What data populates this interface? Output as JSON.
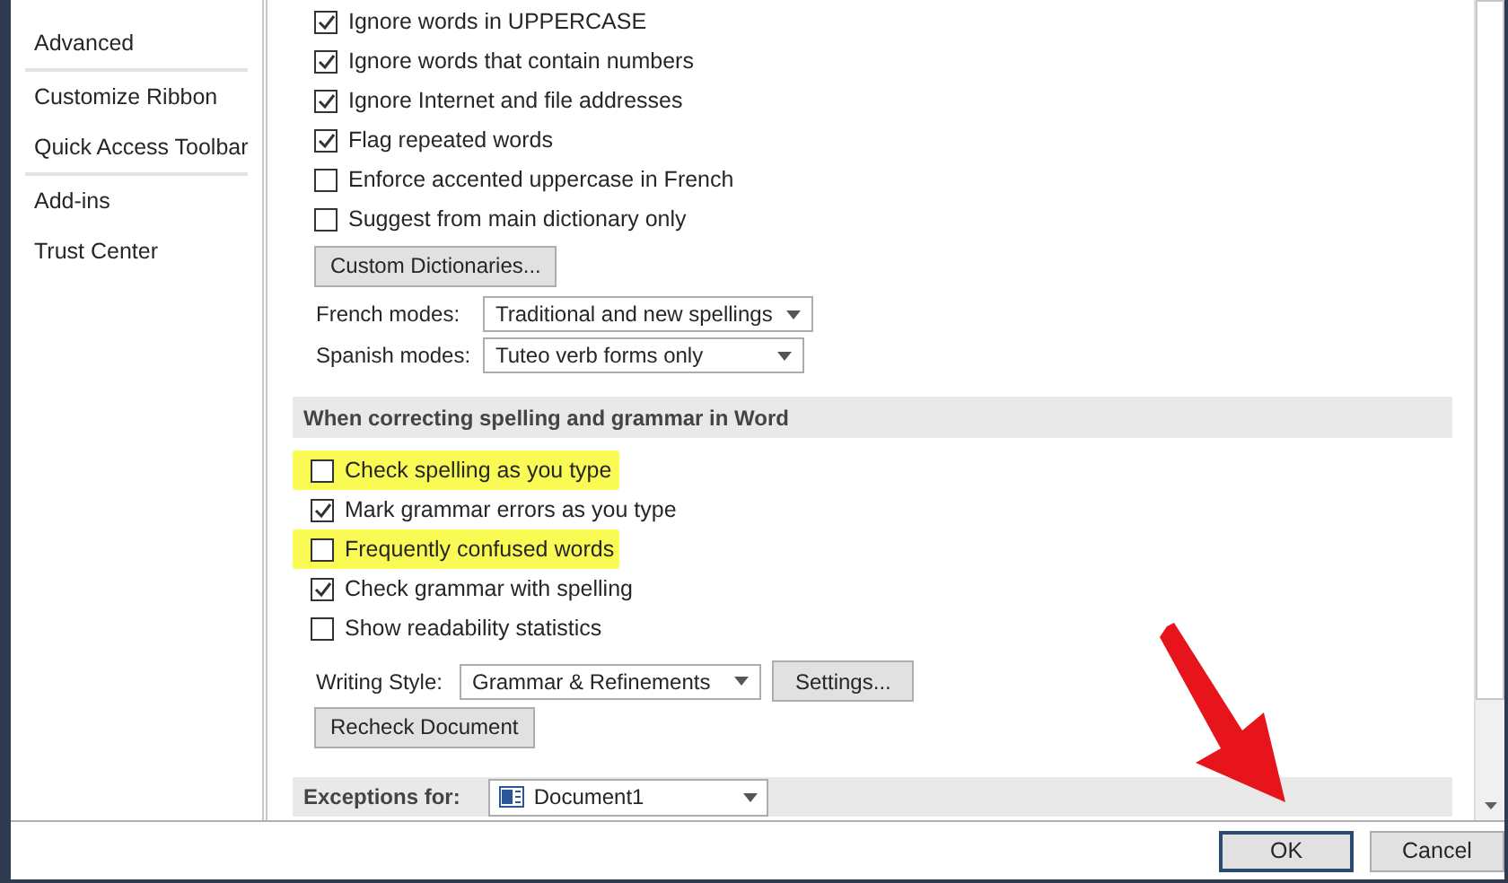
{
  "sidebar": {
    "items": [
      {
        "label": "Advanced",
        "selected": false,
        "divider_after": true
      },
      {
        "label": "Customize Ribbon",
        "selected": false,
        "divider_after": false
      },
      {
        "label": "Quick Access Toolbar",
        "selected": false,
        "divider_after": true
      },
      {
        "label": "Add-ins",
        "selected": false,
        "divider_after": false
      },
      {
        "label": "Trust Center",
        "selected": false,
        "divider_after": false
      }
    ]
  },
  "office_options": [
    {
      "label": "Ignore words in UPPERCASE",
      "checked": true
    },
    {
      "label": "Ignore words that contain numbers",
      "checked": true
    },
    {
      "label": "Ignore Internet and file addresses",
      "checked": true
    },
    {
      "label": "Flag repeated words",
      "checked": true
    },
    {
      "label": "Enforce accented uppercase in French",
      "checked": false
    },
    {
      "label": "Suggest from main dictionary only",
      "checked": false
    }
  ],
  "custom_dictionaries_button": "Custom Dictionaries...",
  "modes": [
    {
      "label": "French modes:",
      "value": "Traditional and new spellings"
    },
    {
      "label": "Spanish modes:",
      "value": "Tuteo verb forms only"
    }
  ],
  "word_section": {
    "title": "When correcting spelling and grammar in Word",
    "options": [
      {
        "label": "Check spelling as you type",
        "checked": false,
        "highlighted": true
      },
      {
        "label": "Mark grammar errors as you type",
        "checked": true,
        "highlighted": false
      },
      {
        "label": "Frequently confused words",
        "checked": false,
        "highlighted": true
      },
      {
        "label": "Check grammar with spelling",
        "checked": true,
        "highlighted": false
      },
      {
        "label": "Show readability statistics",
        "checked": false,
        "highlighted": false
      }
    ],
    "writing_style": {
      "label": "Writing Style:",
      "value": "Grammar & Refinements",
      "settings_button": "Settings..."
    },
    "recheck_button": "Recheck Document"
  },
  "exceptions": {
    "label": "Exceptions for:",
    "value": "Document1"
  },
  "buttons": [
    {
      "label": "OK",
      "default": true
    },
    {
      "label": "Cancel",
      "default": false
    }
  ]
}
